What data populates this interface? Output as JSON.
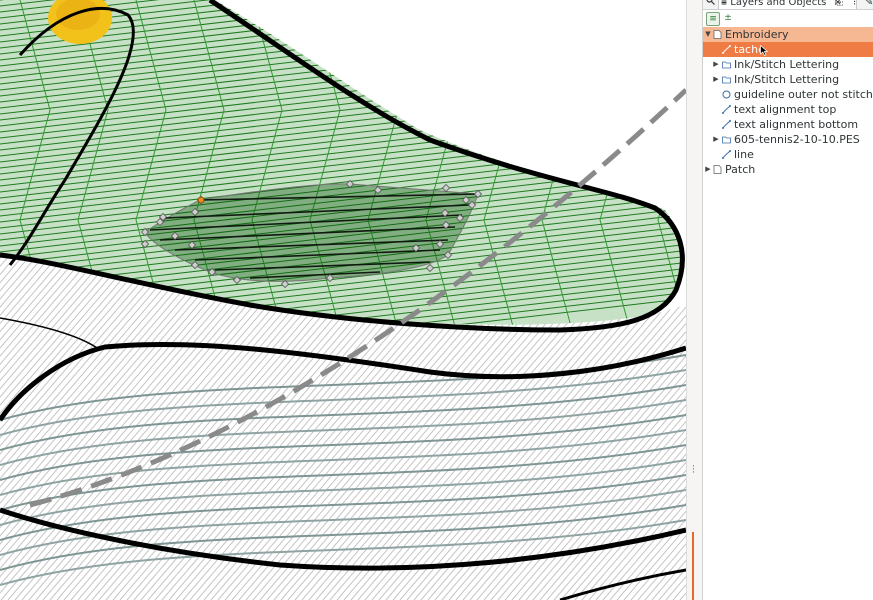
{
  "panel": {
    "search_icon": "search-icon",
    "tab_title": "Layers and Objects",
    "close_glyph": "×"
  },
  "toolbar": {
    "new_layer_icon": "layers-icon",
    "add_icon": "add-sublayer-icon"
  },
  "tree": [
    {
      "label": "Embroidery",
      "kind": "layer",
      "expander": "expanded",
      "state": "highlighted"
    },
    {
      "label": "tache",
      "kind": "path",
      "expander": "none",
      "state": "selected"
    },
    {
      "label": "Ink/Stitch Lettering",
      "kind": "group",
      "expander": "collapsed",
      "state": "normal"
    },
    {
      "label": "Ink/Stitch Lettering",
      "kind": "group",
      "expander": "collapsed",
      "state": "normal"
    },
    {
      "label": "guideline outer not stitched",
      "kind": "circle",
      "expander": "none",
      "state": "normal"
    },
    {
      "label": "text alignment top",
      "kind": "path",
      "expander": "none",
      "state": "normal"
    },
    {
      "label": "text alignment bottom",
      "kind": "path",
      "expander": "none",
      "state": "normal"
    },
    {
      "label": "605-tennis2-10-10.PES",
      "kind": "group",
      "expander": "collapsed",
      "state": "normal"
    },
    {
      "label": "line",
      "kind": "path",
      "expander": "none",
      "state": "normal"
    },
    {
      "label": "Patch",
      "kind": "layer",
      "expander": "collapsed",
      "state": "normal"
    }
  ],
  "colors": {
    "selection": "#ef7b45",
    "layer_highlight": "#f6b892",
    "fill_green": "#2f8a2f",
    "stitch_dark_green": "#0f5a0f",
    "outline": "#000000",
    "guideline": "#8a8a8a",
    "gray_stitches": "#bdbdbd",
    "blue_gray_stitches": "#7f9594",
    "yellow": "#f2c21b"
  }
}
